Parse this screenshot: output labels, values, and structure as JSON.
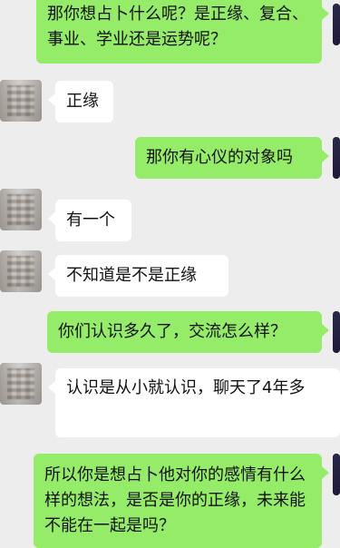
{
  "messages": [
    {
      "id": 1,
      "side": "out",
      "text": "那你想占卜什么呢？是正缘、复合、事业、学业还是运势呢？"
    },
    {
      "id": 2,
      "side": "in",
      "text": "正缘"
    },
    {
      "id": 3,
      "side": "out",
      "text": "那你有心仪的对象吗"
    },
    {
      "id": 4,
      "side": "in",
      "text": "有一个"
    },
    {
      "id": 5,
      "side": "in",
      "text": "不知道是不是正缘"
    },
    {
      "id": 6,
      "side": "out",
      "text": "你们认识多久了，交流怎么样？"
    },
    {
      "id": 7,
      "side": "in",
      "text": "认识是从小就认识，聊天了4年多"
    },
    {
      "id": 8,
      "side": "out",
      "text": "所以你是想占卜他对你的感情有什么样的想法，是否是你的正缘，未来能不能在一起是吗？"
    }
  ]
}
